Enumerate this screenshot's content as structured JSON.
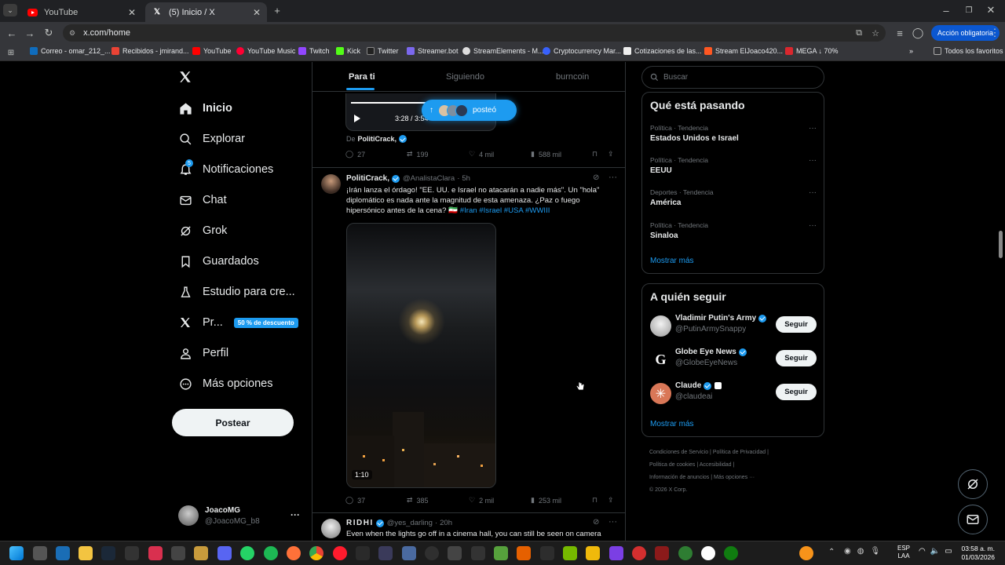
{
  "browser": {
    "tabs": [
      {
        "title": "YouTube",
        "active": false
      },
      {
        "title": "(5) Inicio / X",
        "active": true
      }
    ],
    "url": "x.com/home",
    "profile_action": "Acción obligatoria",
    "bookmarks": [
      {
        "label": "Correo - omar_212_..."
      },
      {
        "label": "Recibidos - jmirand..."
      },
      {
        "label": "YouTube"
      },
      {
        "label": "YouTube Music"
      },
      {
        "label": "Twitch"
      },
      {
        "label": "Kick"
      },
      {
        "label": "Twitter"
      },
      {
        "label": "Streamer.bot"
      },
      {
        "label": "StreamElements - M..."
      },
      {
        "label": "Cryptocurrency Mar..."
      },
      {
        "label": "Cotizaciones de las..."
      },
      {
        "label": "Stream ElJoaco420..."
      },
      {
        "label": "MEGA ↓ 70%"
      }
    ],
    "all_favorites": "Todos los favoritos"
  },
  "nav": {
    "items": [
      {
        "label": "Inicio",
        "icon": "home-icon"
      },
      {
        "label": "Explorar",
        "icon": "search-icon"
      },
      {
        "label": "Notificaciones",
        "icon": "bell-icon",
        "badge": "5"
      },
      {
        "label": "Chat",
        "icon": "mail-icon"
      },
      {
        "label": "Grok",
        "icon": "grok-icon"
      },
      {
        "label": "Guardados",
        "icon": "bookmark-icon"
      },
      {
        "label": "Estudio para cre...",
        "icon": "studio-icon"
      },
      {
        "label": "Pr...",
        "icon": "x-icon",
        "promo": "50 % de descuento"
      },
      {
        "label": "Perfil",
        "icon": "person-icon"
      },
      {
        "label": "Más opciones",
        "icon": "more-circle-icon"
      }
    ],
    "post_button": "Postear",
    "account": {
      "name": "JoacoMG",
      "handle": "@JoacoMG_b8",
      "more": "···"
    }
  },
  "timeline": {
    "tabs": [
      "Para ti",
      "Siguiendo",
      "burncoin"
    ],
    "posted_pill": "posteó",
    "prev_tweet": {
      "video_time": "3:28 / 3:54",
      "from_label": "De",
      "from_name": "PolitiCrack,",
      "actions": {
        "replies": "27",
        "reposts": "199",
        "likes": "4 mil",
        "views": "588 mil"
      }
    },
    "tweet": {
      "name": "PolitiCrack,",
      "handle": "@AnalistaClara",
      "time": "5h",
      "text": "¡Irán lanza el órdago! \"EE. UU. e Israel no atacarán a nadie más\". Un \"hola\" diplomático es nada ante la magnitud de esta amenaza. ¿Paz o fuego hipersónico antes de la cena? 🇮🇷",
      "hashtags": "#Iran #Israel #USA #WWIII",
      "video_duration": "1:10",
      "actions": {
        "replies": "37",
        "reposts": "385",
        "likes": "2 mil",
        "views": "253 mil"
      }
    },
    "next_tweet": {
      "name": "RIDHI",
      "handle": "@yes_darling",
      "time": "20h",
      "text": "Even when the lights go off in a cinema hall, you can still be seen on camera"
    }
  },
  "sidebar": {
    "search_placeholder": "Buscar",
    "trending_title": "Qué está pasando",
    "trends": [
      {
        "category": "Política · Tendencia",
        "name": "Estados Unidos e Israel"
      },
      {
        "category": "Política · Tendencia",
        "name": "EEUU"
      },
      {
        "category": "Deportes · Tendencia",
        "name": "América"
      },
      {
        "category": "Política · Tendencia",
        "name": "Sinaloa"
      }
    ],
    "show_more": "Mostrar más",
    "who_to_follow_title": "A quién seguir",
    "follow": [
      {
        "name": "Vladimir Putin's Army",
        "handle": "@PutinArmySnappy",
        "button": "Seguir"
      },
      {
        "name": "Globe Eye News",
        "handle": "@GlobeEyeNews",
        "button": "Seguir"
      },
      {
        "name": "Claude",
        "handle": "@claudeai",
        "button": "Seguir"
      }
    ],
    "show_more_2": "Mostrar más",
    "footer": {
      "l1a": "Condiciones de Servicio",
      "l1b": "Política de Privacidad",
      "l2a": "Política de cookies",
      "l2b": "Accesibilidad",
      "l3a": "Información de anuncios",
      "l3b": "Más opciones ···",
      "copyright": "© 2026 X Corp."
    }
  },
  "taskbar": {
    "lang": "ESP",
    "lang2": "LAA",
    "time": "03:58 a. m.",
    "date": "01/03/2026"
  },
  "colors": {
    "accent": "#1d9bf0",
    "background": "#000000",
    "border": "#2f3336",
    "muted": "#71767b"
  }
}
